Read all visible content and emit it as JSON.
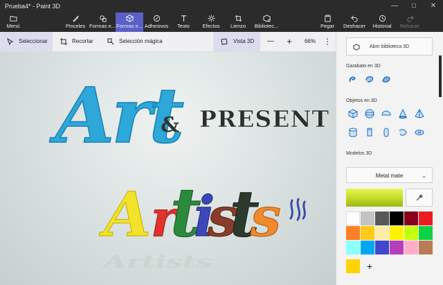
{
  "window": {
    "title": "Prueba4* - Paint 3D"
  },
  "ribbon": {
    "menu": "Menú",
    "items": [
      {
        "label": "Pinceles"
      },
      {
        "label": "Formas e..."
      },
      {
        "label": "Formas e..."
      },
      {
        "label": "Adhesivos"
      },
      {
        "label": "Texto"
      },
      {
        "label": "Efectos"
      },
      {
        "label": "Lienzo"
      },
      {
        "label": "Bibliotec..."
      }
    ],
    "right": [
      {
        "label": "Pegar"
      },
      {
        "label": "Deshacer"
      },
      {
        "label": "Historial"
      },
      {
        "label": "Rehacer"
      }
    ],
    "active_index": 2
  },
  "toolbar": {
    "select": "Seleccionar",
    "crop": "Recortar",
    "magic_select": "Selección mágica",
    "view3d": "Vista 3D",
    "zoom_minus": "—",
    "zoom_plus": "+",
    "zoom": "66%"
  },
  "panel": {
    "library_button": "Abrir biblioteca 3D",
    "doodle_header": "Garabato en 3D",
    "objects_header": "Objetos en 3D",
    "models_header": "Modelos 3D",
    "material": "Metal mate",
    "selected_color": "#c8e02a",
    "current_color": "#ffd400",
    "add_color": "+",
    "palette": [
      "#ffffff",
      "#c3c3c3",
      "#585858",
      "#000000",
      "#88001b",
      "#ec1c24",
      "#ff7f27",
      "#ffca18",
      "#fdeca6",
      "#fff200",
      "#c4ff0e",
      "#0ed145",
      "#8cfffb",
      "#00a8f3",
      "#3f48cc",
      "#b83dba",
      "#ffaec8",
      "#b97a56"
    ]
  },
  "canvas_text": {
    "line1": "Art",
    "amp": "&",
    "present": "PRESENT",
    "line2": "Artists"
  },
  "colors": {
    "accent": "#5b5fc7",
    "art_blue": "#2aa6d8"
  }
}
